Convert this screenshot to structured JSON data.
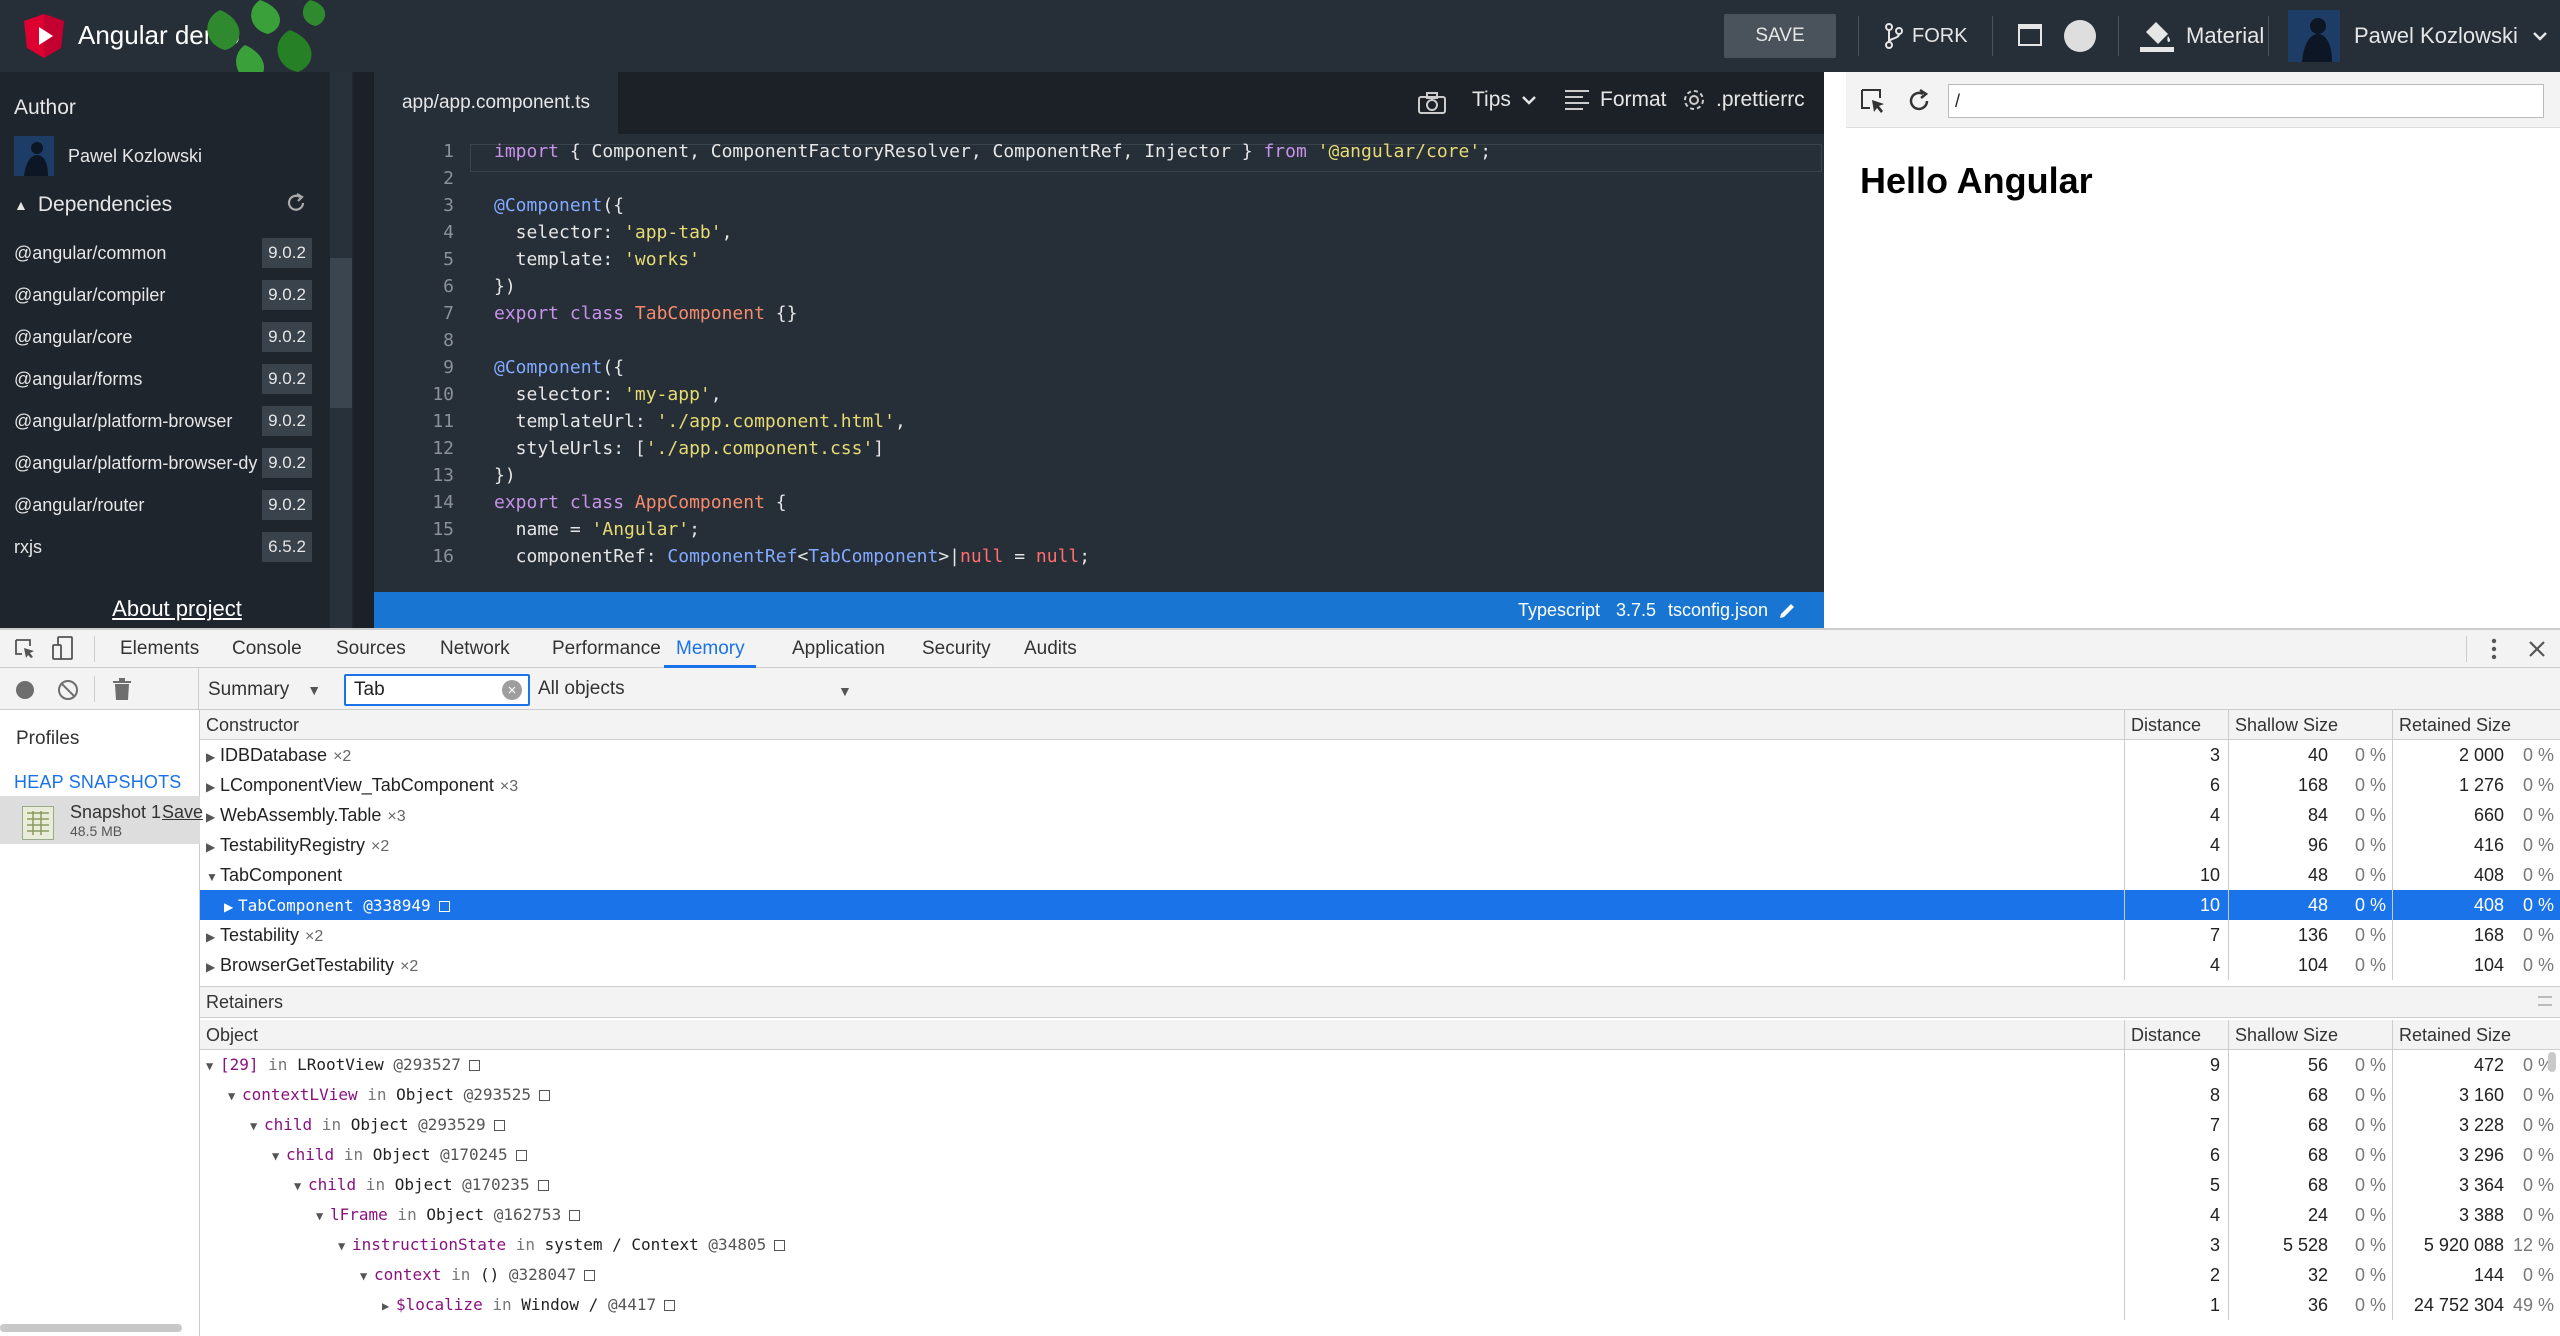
{
  "app": {
    "title": "Angular demo",
    "save_label": "SAVE",
    "fork_label": "FORK",
    "material_label": "Material",
    "user_name": "Pawel Kozlowski"
  },
  "sidebar": {
    "author_label": "Author",
    "author_name": "Pawel Kozlowski",
    "dependencies_label": "Dependencies",
    "dependencies": [
      {
        "name": "@angular/common",
        "version": "9.0.2"
      },
      {
        "name": "@angular/compiler",
        "version": "9.0.2"
      },
      {
        "name": "@angular/core",
        "version": "9.0.2"
      },
      {
        "name": "@angular/forms",
        "version": "9.0.2"
      },
      {
        "name": "@angular/platform-browser",
        "version": "9.0.2"
      },
      {
        "name": "@angular/platform-browser-dy",
        "version": "9.0.2"
      },
      {
        "name": "@angular/router",
        "version": "9.0.2"
      },
      {
        "name": "rxjs",
        "version": "6.5.2"
      }
    ],
    "about_link": "About project"
  },
  "editor": {
    "file_tab": "app/app.component.ts",
    "tips_label": "Tips",
    "format_label": "Format",
    "prettierrc_label": ".prettierrc",
    "line_numbers": [
      "1",
      "2",
      "3",
      "4",
      "5",
      "6",
      "7",
      "8",
      "9",
      "10",
      "11",
      "12",
      "13",
      "14",
      "15",
      "16"
    ],
    "status": {
      "language": "Typescript",
      "version": "3.7.5",
      "tsconfig": "tsconfig.json"
    }
  },
  "preview": {
    "url": "/",
    "heading": "Hello Angular"
  },
  "devtools": {
    "tabs": [
      "Elements",
      "Console",
      "Sources",
      "Network",
      "Performance",
      "Memory",
      "Application",
      "Security",
      "Audits"
    ],
    "active_tab": "Memory",
    "summary_select": "Summary",
    "class_filter": "Tab",
    "objects_filter": "All objects",
    "profiles_label": "Profiles",
    "heap_snapshots_label": "HEAP SNAPSHOTS",
    "snapshot": {
      "name": "Snapshot 1",
      "save": "Save",
      "size": "48.5 MB"
    },
    "constructor_columns": [
      "Constructor",
      "Distance",
      "Shallow Size",
      "Retained Size"
    ],
    "constructor_rows": [
      {
        "name": "IDBDatabase",
        "count": "×2",
        "distance": "3",
        "shallow": "40",
        "shallow_pct": "0 %",
        "retained": "2 000",
        "retained_pct": "0 %"
      },
      {
        "name": "LComponentView_TabComponent",
        "count": "×3",
        "distance": "6",
        "shallow": "168",
        "shallow_pct": "0 %",
        "retained": "1 276",
        "retained_pct": "0 %"
      },
      {
        "name": "WebAssembly.Table",
        "count": "×3",
        "distance": "4",
        "shallow": "84",
        "shallow_pct": "0 %",
        "retained": "660",
        "retained_pct": "0 %"
      },
      {
        "name": "TestabilityRegistry",
        "count": "×2",
        "distance": "4",
        "shallow": "96",
        "shallow_pct": "0 %",
        "retained": "416",
        "retained_pct": "0 %"
      },
      {
        "name": "TabComponent",
        "count": "",
        "distance": "10",
        "shallow": "48",
        "shallow_pct": "0 %",
        "retained": "408",
        "retained_pct": "0 %"
      },
      {
        "name": "TabComponent @338949",
        "count": "",
        "distance": "10",
        "shallow": "48",
        "shallow_pct": "0 %",
        "retained": "408",
        "retained_pct": "0 %"
      },
      {
        "name": "Testability",
        "count": "×2",
        "distance": "7",
        "shallow": "136",
        "shallow_pct": "0 %",
        "retained": "168",
        "retained_pct": "0 %"
      },
      {
        "name": "BrowserGetTestability",
        "count": "×2",
        "distance": "4",
        "shallow": "104",
        "shallow_pct": "0 %",
        "retained": "104",
        "retained_pct": "0 %"
      }
    ],
    "retainers_label": "Retainers",
    "retainer_columns": [
      "Object",
      "Distance",
      "Shallow Size",
      "Retained Size"
    ],
    "retainer_rows": [
      {
        "prop": "[29]",
        "rest": "LRootView",
        "id": "@293527",
        "distance": "9",
        "shallow": "56",
        "shallow_pct": "0 %",
        "retained": "472",
        "retained_pct": "0 %"
      },
      {
        "prop": "contextLView",
        "rest": "Object",
        "id": "@293525",
        "distance": "8",
        "shallow": "68",
        "shallow_pct": "0 %",
        "retained": "3 160",
        "retained_pct": "0 %"
      },
      {
        "prop": "child",
        "rest": "Object",
        "id": "@293529",
        "distance": "7",
        "shallow": "68",
        "shallow_pct": "0 %",
        "retained": "3 228",
        "retained_pct": "0 %"
      },
      {
        "prop": "child",
        "rest": "Object",
        "id": "@170245",
        "distance": "6",
        "shallow": "68",
        "shallow_pct": "0 %",
        "retained": "3 296",
        "retained_pct": "0 %"
      },
      {
        "prop": "child",
        "rest": "Object",
        "id": "@170235",
        "distance": "5",
        "shallow": "68",
        "shallow_pct": "0 %",
        "retained": "3 364",
        "retained_pct": "0 %"
      },
      {
        "prop": "lFrame",
        "rest": "Object",
        "id": "@162753",
        "distance": "4",
        "shallow": "24",
        "shallow_pct": "0 %",
        "retained": "3 388",
        "retained_pct": "0 %"
      },
      {
        "prop": "instructionState",
        "rest": "system / Context",
        "id": "@34805",
        "distance": "3",
        "shallow": "5 528",
        "shallow_pct": "0 %",
        "retained": "5 920 088",
        "retained_pct": "12 %"
      },
      {
        "prop": "context",
        "rest": "()",
        "id": "@328047",
        "distance": "2",
        "shallow": "32",
        "shallow_pct": "0 %",
        "retained": "144",
        "retained_pct": "0 %"
      },
      {
        "prop": "$localize",
        "rest": "Window /",
        "id": "@4417",
        "distance": "1",
        "shallow": "36",
        "shallow_pct": "0 %",
        "retained": "24 752 304",
        "retained_pct": "49 %"
      }
    ]
  }
}
